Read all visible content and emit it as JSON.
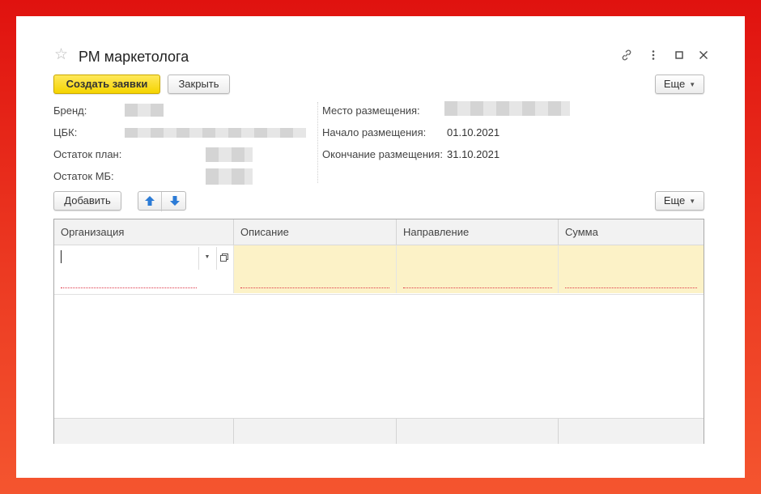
{
  "window": {
    "title": "РМ маркетолога",
    "icons": [
      "star-icon",
      "link-icon",
      "more-vertical-icon",
      "maximize-icon",
      "close-icon"
    ]
  },
  "toolbar": {
    "create_label": "Создать заявки",
    "close_label": "Закрыть",
    "more_label": "Еще"
  },
  "fields_left": [
    {
      "label": "Бренд:"
    },
    {
      "label": "ЦБК:"
    },
    {
      "label": "Остаток план:"
    },
    {
      "label": "Остаток МБ:"
    }
  ],
  "fields_right": [
    {
      "label": "Место размещения:",
      "value": ""
    },
    {
      "label": "Начало размещения:",
      "value": "01.10.2021"
    },
    {
      "label": "Окончание размещения:",
      "value": "31.10.2021"
    }
  ],
  "table_toolbar": {
    "add_label": "Добавить",
    "more_label": "Еще",
    "up_icon": "arrow-up-icon",
    "down_icon": "arrow-down-icon"
  },
  "table": {
    "columns": [
      "Организация",
      "Описание",
      "Направление",
      "Сумма"
    ],
    "rows": [
      {
        "organization": "",
        "description": "",
        "direction": "",
        "amount": ""
      }
    ]
  },
  "colors": {
    "background": "#e8241a",
    "primary_button": "#f5d400",
    "editable_cell": "#fcf2c7",
    "header_bg": "#f2f2f2",
    "accent_arrow": "#2b7bd6"
  }
}
